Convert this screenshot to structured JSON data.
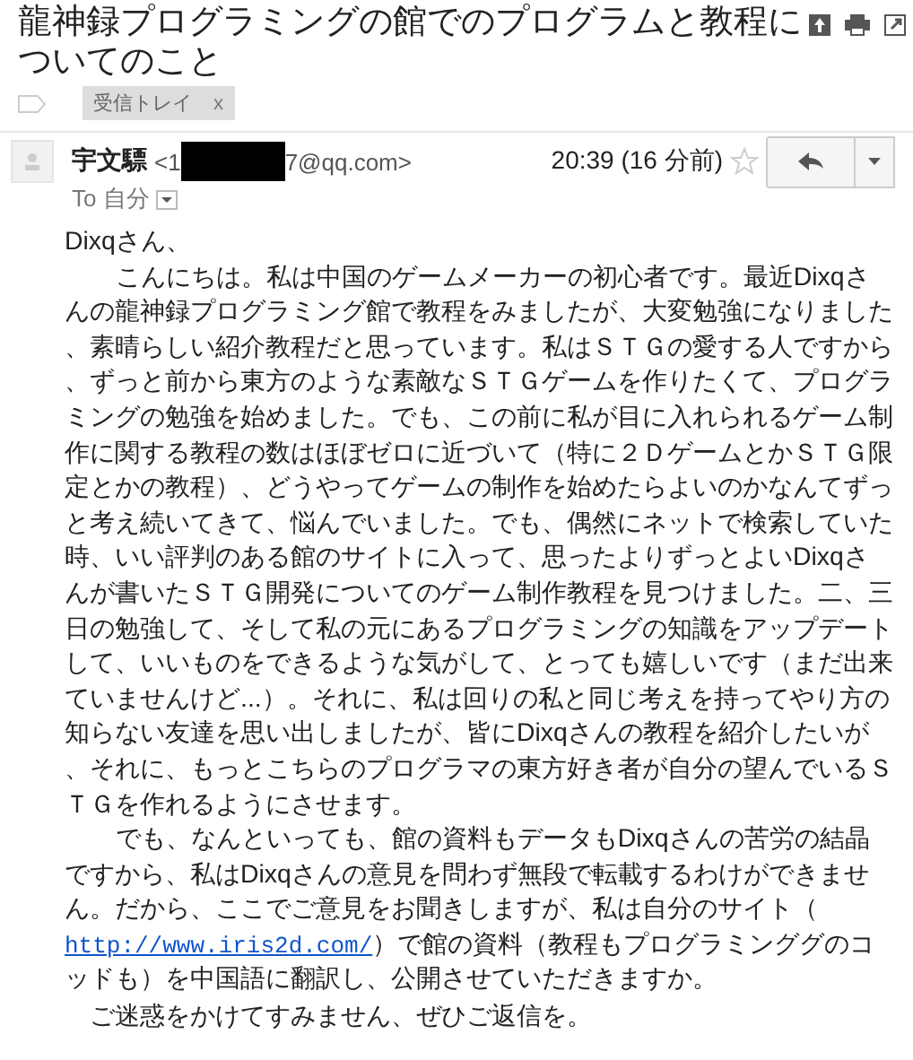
{
  "subject": {
    "title": "龍神録プログラミングの館でのプログラムと教程についてのこと",
    "tag": {
      "label": "受信トレイ",
      "remove": "x"
    }
  },
  "message": {
    "sender_name": "宇文驃",
    "sender_email_start": "<1",
    "sender_email_end": "7@qq.com>",
    "time": "20:39 (16 分前)",
    "starred": false,
    "to": "To 自分"
  },
  "body": {
    "greeting": "Dixqさん、",
    "paragraphs": [
      {
        "text": "こんにちは。私は中国のゲームメーカーの初心者です。最近Dixqさんの龍神録プログラミング館で教程をみましたが、大変勉強になりました、素晴らしい紹介教程だと思っています。私はＳＴＧの愛する人ですから、ずっと前から東方のような素敵なＳＴＧゲームを作りたくて、プログラミングの勉強を始めました。でも、この前に私が目に入れられるゲーム制作に関する教程の数はほぼゼロに近づいて（特に２ＤゲームとかＳＴＧ限定とかの教程）、どうやってゲームの制作を始めたらよいのかなんてずっと考え続いてきて、悩んでいました。でも、偶然にネットで検索していた時、いい評判のある館のサイトに入って、思ったよりずっとよいDixqさんが書いたＳＴＧ開発についてのゲーム制作教程を見つけました。二、三日の勉強して、そして私の元にあるプログラミングの知識をアップデートして、いいものをできるような気がして、とっても嬉しいです（まだ出来ていませんけど...）。それに、私は回りの私と同じ考えを持ってやり方の知らない友達を思い出しましたが、皆にDixqさんの教程を紹介したいが、それに、もっとこちらのプログラマの東方好き者が自分の望んでいるＳＴＧを作れるようにさせます。"
      }
    ],
    "request": {
      "before": "でも、なんといっても、館の資料もデータもDixqさんの苦労の結晶ですから、私はDixqさんの意見を問わず無段で転載するわけができません。だから、ここでご意見をお聞きしますが、私は自分のサイト（",
      "link": "http://www.iris2d.com/",
      "after": "）で館の資料（教程もプログラミンググのコッドも）を中国語に翻訳し、公開させていただきますか。"
    },
    "closing": "ご迷惑をかけてすみません、ぜひご返信を。"
  }
}
